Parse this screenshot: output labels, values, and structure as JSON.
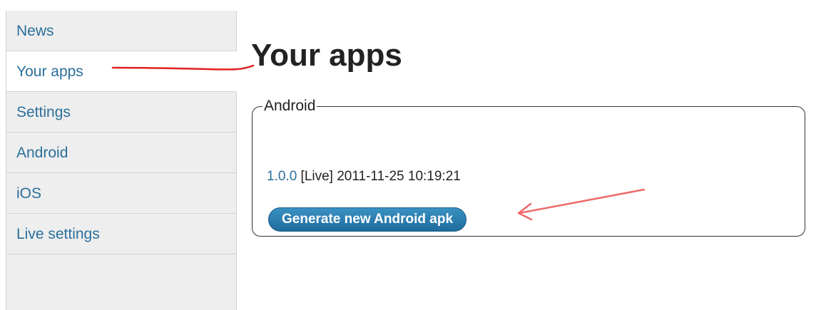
{
  "sidebar": {
    "items": [
      {
        "label": "News"
      },
      {
        "label": "Your apps"
      },
      {
        "label": "Settings"
      },
      {
        "label": "Android"
      },
      {
        "label": "iOS"
      },
      {
        "label": "Live settings"
      }
    ],
    "active_index": 1
  },
  "main": {
    "title": "Your apps",
    "android_section": {
      "legend": "Android",
      "version": "1.0.0",
      "status_and_date": "[Live] 2011-11-25 10:19:21",
      "generate_button_label": "Generate new Android apk"
    }
  },
  "colors": {
    "link": "#2a6f9b",
    "sidebar_bg": "#eeeeee",
    "button_bg": "#2a80b3",
    "annotation_red": "#e02020",
    "annotation_pink": "#ef6a6a"
  }
}
